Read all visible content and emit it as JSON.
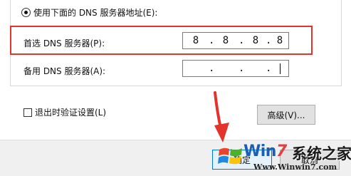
{
  "dns": {
    "radio_label": "使用下面的 DNS 服务器地址(E):",
    "preferred": {
      "label": "首选 DNS 服务器(P):",
      "segments": [
        "8",
        "8",
        "8",
        "8"
      ]
    },
    "alternate": {
      "label": "备用 DNS 服务器(A):",
      "segments": [
        "",
        "",
        "",
        ""
      ]
    }
  },
  "options": {
    "validate_label": "退出时验证设置(L)",
    "advanced_label": "高级(V)..."
  },
  "footer": {
    "ok_label": "确定",
    "cancel_label": "取消"
  },
  "watermark": {
    "brand_prefix": "Win",
    "brand_digit": "7",
    "title": "系统之家",
    "url": "Www.Winwin7.com"
  },
  "colors": {
    "highlight": "#e2332c",
    "arrow": "#e2332c",
    "ok_border": "#0078d7"
  },
  "icons": {
    "annotation_arrow": "red-arrow-icon",
    "watermark_logo": "windows-flag-icon"
  }
}
